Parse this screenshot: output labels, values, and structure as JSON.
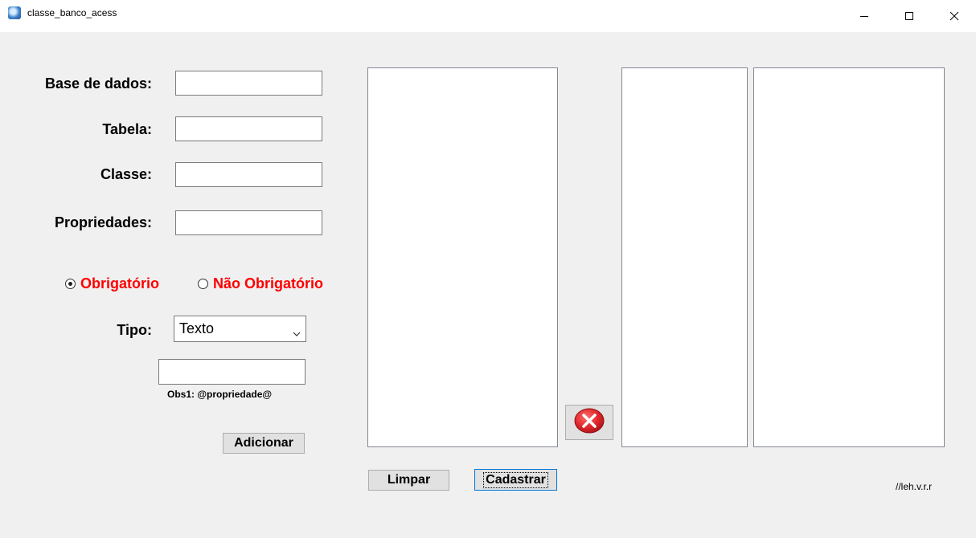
{
  "window": {
    "title": "classe_banco_acess",
    "minimize_icon": "minimize-icon",
    "maximize_icon": "maximize-icon",
    "close_icon": "close-icon"
  },
  "form": {
    "base_label": "Base de dados:",
    "base_value": "",
    "tabela_label": "Tabela:",
    "tabela_value": "",
    "classe_label": "Classe:",
    "classe_value": "",
    "propriedades_label": "Propriedades:",
    "propriedades_value": "",
    "radio_obrigatorio": "Obrigatório",
    "radio_nao_obrigatorio": "Não Obrigatório",
    "selected_radio": "Obrigatório",
    "tipo_label": "Tipo:",
    "tipo_value": "Texto",
    "pattern_value": "",
    "obs_text": "Obs1: @propriedade@",
    "adicionar_label": "Adicionar"
  },
  "actions": {
    "limpar_label": "Limpar",
    "cadastrar_label": "Cadastrar",
    "delete_icon": "delete-x-icon"
  },
  "footer": {
    "signature": "//leh.v.r.r"
  },
  "colors": {
    "radio_text": "#ff0000",
    "window_bg": "#f0f0f0",
    "delete_red": "#e0262b"
  }
}
